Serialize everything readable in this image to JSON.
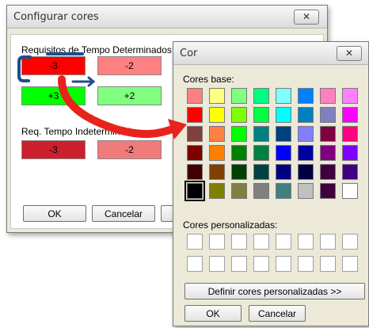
{
  "config_window": {
    "title": "Configurar cores",
    "close_glyph": "✕",
    "section1_label": "Requisitos de Tempo Determinados",
    "section2_label": "Req. Tempo Indeterminados",
    "buttons": [
      {
        "label": "-3",
        "color": "#ff0000"
      },
      {
        "label": "-2",
        "color": "#ff8080"
      },
      {
        "label": "+3",
        "color": "#00ff00"
      },
      {
        "label": "+2",
        "color": "#80ff80"
      },
      {
        "label": "-3",
        "color": "#cc1f2e"
      },
      {
        "label": "-2",
        "color": "#f07b7b"
      }
    ],
    "ok_label": "OK",
    "cancel_label": "Cancelar"
  },
  "color_dialog": {
    "title": "Cor",
    "close_glyph": "✕",
    "base_label": "Cores base:",
    "custom_label": "Cores personalizadas:",
    "define_label": "Definir cores personalizadas >>",
    "ok_label": "OK",
    "cancel_label": "Cancelar",
    "selected_swatch_index": 40,
    "base_colors": [
      "#ff8080",
      "#ffff80",
      "#80ff80",
      "#00ff80",
      "#80ffff",
      "#0080ff",
      "#ff80c0",
      "#ff80ff",
      "#ff0000",
      "#ffff00",
      "#80ff00",
      "#00ff40",
      "#00ffff",
      "#0080c0",
      "#8080c0",
      "#ff00ff",
      "#804040",
      "#ff8040",
      "#00ff00",
      "#008080",
      "#004080",
      "#8080ff",
      "#800040",
      "#ff0080",
      "#800000",
      "#ff8000",
      "#008000",
      "#008040",
      "#0000ff",
      "#0000a0",
      "#800080",
      "#8000ff",
      "#400000",
      "#804000",
      "#004000",
      "#004040",
      "#000080",
      "#000040",
      "#400040",
      "#400080",
      "#000000",
      "#808000",
      "#808040",
      "#808080",
      "#408080",
      "#c0c0c0",
      "#400040",
      "#ffffff"
    ]
  },
  "annotation": {
    "bracket_color": "#1f4e8c",
    "arrow_color": "#e8231c"
  }
}
